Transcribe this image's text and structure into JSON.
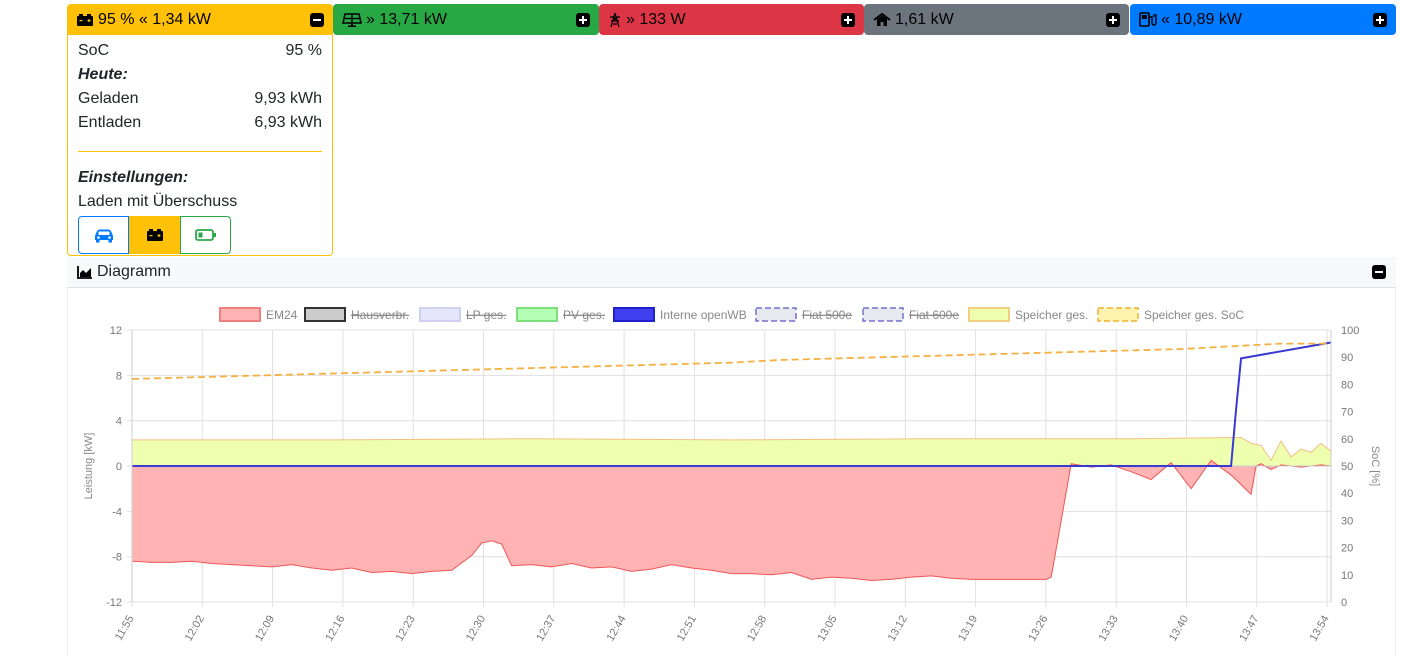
{
  "headers": {
    "battery": "95 % « 1,34 kW",
    "pv": "» 13,71 kW",
    "grid": "» 133 W",
    "house": "1,61 kW",
    "charge": "« 10,89 kW"
  },
  "battery_panel": {
    "soc_label": "SoC",
    "soc_value": "95 %",
    "today_label": "Heute:",
    "charged_label": "Geladen",
    "charged_value": "9,93 kWh",
    "discharged_label": "Entladen",
    "discharged_value": "6,93 kWh",
    "settings_label": "Einstellungen:",
    "mode_label": "Laden mit Überschuss"
  },
  "diagram": {
    "title": "Diagramm"
  },
  "colors": {
    "battery": "#ffc107",
    "pv": "#28a745",
    "grid": "#dc3545",
    "house": "#6c757d",
    "charge": "#007bff"
  },
  "icons": {
    "battery": "car-battery-icon",
    "pv": "solar-panel-icon",
    "grid": "power-tower-icon",
    "house": "house-icon",
    "charge": "charging-station-icon",
    "toggle": "minus-square-icon"
  },
  "chart_data": {
    "type": "line",
    "legend": [
      {
        "name": "EM24",
        "hidden": false,
        "fill": "#ffb3b3",
        "stroke": "#f08080",
        "dash": false
      },
      {
        "name": "Hausverbr.",
        "hidden": true,
        "fill": "#cccccc",
        "stroke": "#333333",
        "dash": false
      },
      {
        "name": "LP ges.",
        "hidden": true,
        "fill": "#e6e6fa",
        "stroke": "#d0d0f0",
        "dash": false
      },
      {
        "name": "PV ges.",
        "hidden": true,
        "fill": "#b3ffb3",
        "stroke": "#7fdf7f",
        "dash": false
      },
      {
        "name": "Interne openWB",
        "hidden": false,
        "fill": "#4040ee",
        "stroke": "#2020cc",
        "dash": false
      },
      {
        "name": "Fiat 500e",
        "hidden": true,
        "fill": "#e8e8f0",
        "stroke": "#7070cc",
        "dash": true
      },
      {
        "name": "Fiat 600e",
        "hidden": true,
        "fill": "#e8e8f0",
        "stroke": "#7070cc",
        "dash": true
      },
      {
        "name": "Speicher ges.",
        "hidden": false,
        "fill": "#efffb0",
        "stroke": "#f0d080",
        "dash": false
      },
      {
        "name": "Speicher ges. SoC",
        "hidden": false,
        "fill": "#fff3b0",
        "stroke": "#f0b030",
        "dash": true
      }
    ],
    "x_ticks": [
      "11:55",
      "12:02",
      "12:09",
      "12:16",
      "12:23",
      "12:30",
      "12:37",
      "12:44",
      "12:51",
      "12:58",
      "13:05",
      "13:12",
      "13:19",
      "13:26",
      "13:33",
      "13:40",
      "13:47",
      "13:54"
    ],
    "y_left": {
      "label": "Leistung [kW]",
      "ticks": [
        12,
        8,
        4,
        0,
        -4,
        -8,
        -12
      ],
      "range": [
        -12,
        12
      ]
    },
    "y_right": {
      "label": "SoC [%]",
      "ticks": [
        100,
        90,
        80,
        70,
        60,
        50,
        40,
        30,
        20,
        10,
        0
      ],
      "range": [
        0,
        100
      ]
    },
    "series": [
      {
        "name": "EM24",
        "x": [
          0,
          2,
          4,
          6,
          8,
          10,
          12,
          14,
          16,
          18,
          20,
          22,
          24,
          26,
          28,
          30,
          32,
          34,
          35,
          36,
          37,
          38,
          40,
          42,
          44,
          46,
          48,
          50,
          52,
          54,
          56,
          58,
          60,
          62,
          64,
          66,
          68,
          70,
          72,
          74,
          76,
          78,
          80,
          82,
          84,
          86,
          88,
          90,
          91,
          91.5,
          92,
          94,
          96,
          98,
          100,
          102,
          104,
          106,
          108,
          110,
          112,
          112.5,
          113,
          114,
          115,
          116,
          117,
          118,
          119,
          120
        ],
        "y": [
          -8.4,
          -8.5,
          -8.5,
          -8.4,
          -8.6,
          -8.7,
          -8.8,
          -8.9,
          -8.7,
          -9.0,
          -9.2,
          -9.0,
          -9.4,
          -9.3,
          -9.5,
          -9.3,
          -9.2,
          -7.9,
          -6.8,
          -6.6,
          -6.9,
          -8.8,
          -8.7,
          -8.9,
          -8.6,
          -9.0,
          -8.9,
          -9.3,
          -9.1,
          -8.7,
          -9.0,
          -9.2,
          -9.5,
          -9.5,
          -9.6,
          -9.4,
          -10.0,
          -9.8,
          -9.9,
          -10.1,
          -10.0,
          -9.8,
          -9.7,
          -9.9,
          -10.0,
          -10.0,
          -10.0,
          -10.0,
          -10.0,
          -10.0,
          -9.8,
          0.2,
          -0.1,
          0.1,
          -0.5,
          -1.2,
          0.3,
          -2.0,
          0.5,
          -0.8,
          -2.5,
          0.0,
          0.2,
          -0.3,
          0.1,
          0.0,
          -0.1,
          0.0,
          0.1,
          0.0
        ]
      },
      {
        "name": "Interne openWB",
        "x": [
          0,
          110,
          110.5,
          111,
          120
        ],
        "y": [
          0,
          0,
          5,
          9.5,
          10.9
        ]
      },
      {
        "name": "Speicher ges.",
        "x": [
          0,
          20,
          40,
          60,
          80,
          100,
          110,
          111,
          112,
          113,
          114,
          115,
          116,
          117,
          118,
          119,
          120
        ],
        "y": [
          2.3,
          2.3,
          2.4,
          2.3,
          2.4,
          2.4,
          2.5,
          2.5,
          2.0,
          1.8,
          0.5,
          2.2,
          0.8,
          1.5,
          1.2,
          2.0,
          1.3
        ]
      },
      {
        "name": "Speicher ges. SoC",
        "x": [
          0,
          5,
          10,
          15,
          20,
          25,
          30,
          35,
          40,
          45,
          50,
          55,
          60,
          65,
          70,
          75,
          80,
          85,
          90,
          95,
          100,
          105,
          110,
          115,
          120
        ],
        "y": [
          82,
          82.5,
          83,
          83.5,
          84,
          84.5,
          85,
          85.5,
          86,
          86.5,
          87,
          87.5,
          88,
          89,
          89.5,
          90,
          90.5,
          91,
          91.5,
          92,
          92.5,
          93,
          94,
          95,
          95
        ]
      }
    ]
  }
}
